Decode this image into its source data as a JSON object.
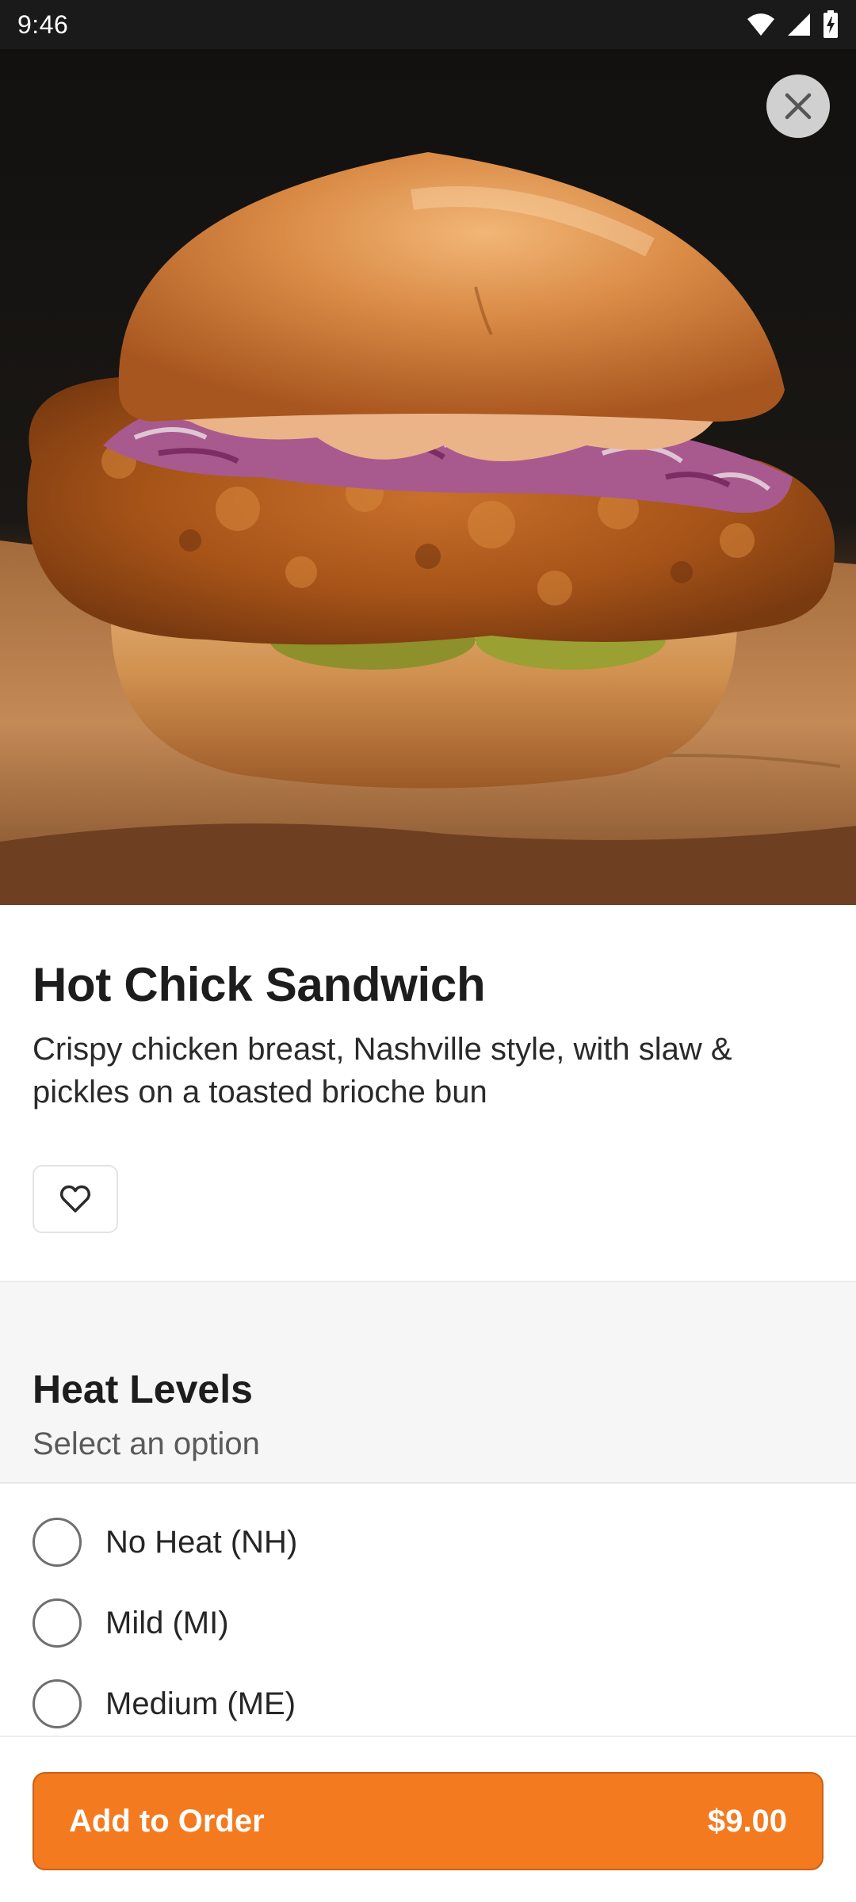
{
  "status_bar": {
    "time": "9:46",
    "icons": [
      "wifi-icon",
      "cellular-signal-icon",
      "battery-charging-icon"
    ]
  },
  "hero": {
    "image_alt": "Hot Chick Sandwich photo",
    "close_icon": "close-icon"
  },
  "item": {
    "title": "Hot Chick Sandwich",
    "description": "Crispy chicken breast, Nashville style, with slaw & pickles on a toasted brioche bun",
    "favorite_icon": "heart-outline-icon"
  },
  "heat_levels": {
    "title": "Heat Levels",
    "subtitle": "Select an option",
    "options": [
      {
        "label": "No Heat (NH)",
        "selected": false
      },
      {
        "label": "Mild (MI)",
        "selected": false
      },
      {
        "label": "Medium (ME)",
        "selected": false
      }
    ]
  },
  "footer": {
    "add_label": "Add to Order",
    "price": "$9.00"
  },
  "colors": {
    "accent": "#f47a20",
    "accent_border": "#c9611a",
    "status_bar": "#1a1a1a",
    "section_bg": "#f6f6f6"
  }
}
